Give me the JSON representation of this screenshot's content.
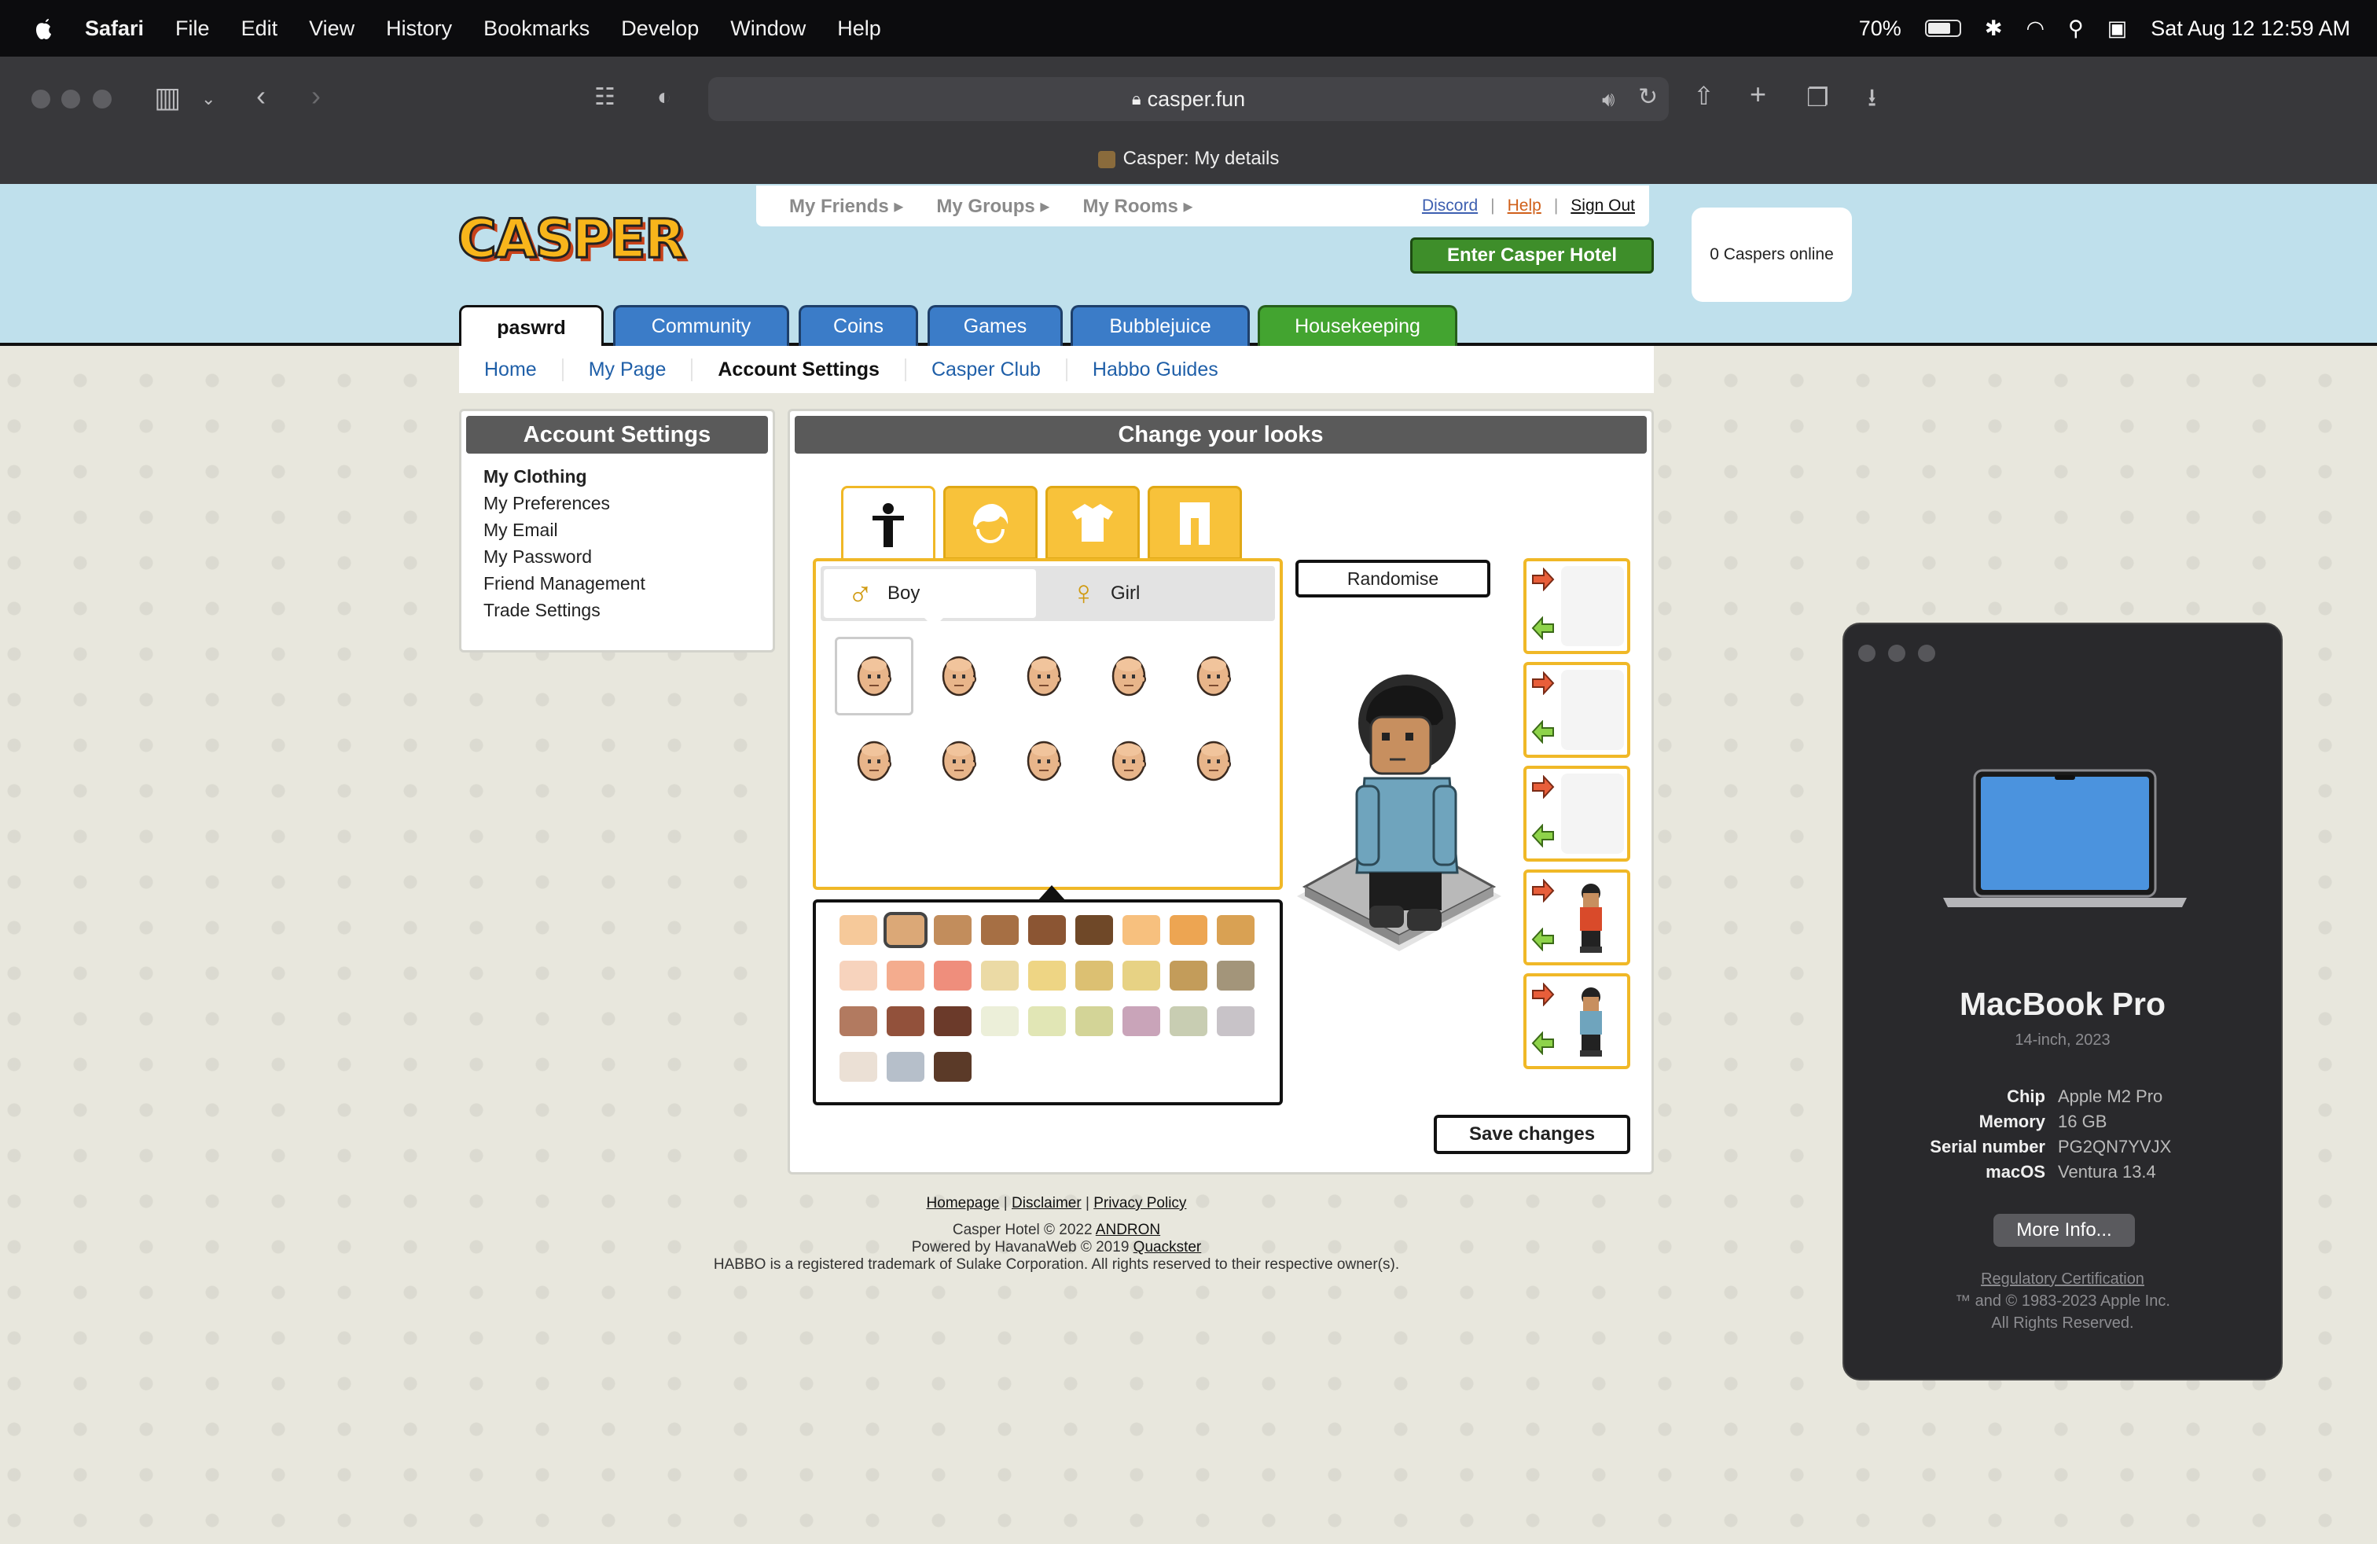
{
  "menubar": {
    "app": "Safari",
    "items": [
      "File",
      "Edit",
      "View",
      "History",
      "Bookmarks",
      "Develop",
      "Window",
      "Help"
    ],
    "battery": "70%",
    "datetime": "Sat Aug 12  12:59 AM"
  },
  "browser": {
    "url": "casper.fun",
    "tab_title": "Casper: My details"
  },
  "site": {
    "logo": "CASPER",
    "subnav": [
      "My Friends",
      "My Groups",
      "My Rooms"
    ],
    "links": {
      "discord": "Discord",
      "help": "Help",
      "signout": "Sign Out"
    },
    "enter_button": "Enter Casper Hotel",
    "online": "0 Caspers online",
    "tabs": [
      "paswrd",
      "Community",
      "Coins",
      "Games",
      "Bubblejuice",
      "Housekeeping"
    ],
    "menu": [
      "Home",
      "My Page",
      "Account Settings",
      "Casper Club",
      "Habbo Guides"
    ]
  },
  "account_settings": {
    "title": "Account Settings",
    "items": [
      "My Clothing",
      "My Preferences",
      "My Email",
      "My Password",
      "Friend Management",
      "Trade Settings"
    ]
  },
  "looks": {
    "title": "Change your looks",
    "boy": "Boy",
    "girl": "Girl",
    "randomise": "Randomise",
    "save": "Save changes",
    "swatch_colors": [
      "#f6c99a",
      "#dba877",
      "#c28d5c",
      "#a66f44",
      "#8b5533",
      "#6f4828",
      "#f7c07e",
      "#eda552",
      "#d9a153",
      "#f7d3bd",
      "#f4ac8e",
      "#ef8e7c",
      "#ebdaa5",
      "#eed584",
      "#dcc072",
      "#e7d284",
      "#c39c5a",
      "#a3957a",
      "#b27a60",
      "#92513b",
      "#6b3a2a",
      "#ecefd9",
      "#e1e6b5",
      "#d3d497",
      "#c9a4b9",
      "#c8cdb2",
      "#c8c3c8",
      "#ebe0d5",
      "#b6bfca",
      "#5b3a28"
    ],
    "selected_swatch": 1
  },
  "footer": {
    "links": [
      "Homepage",
      "Disclaimer",
      "Privacy Policy"
    ],
    "line1_prefix": "Casper Hotel © 2022",
    "line1_link": "ANDRON",
    "line2_prefix": "Powered by HavanaWeb © 2019",
    "line2_link": "Quackster",
    "line3": "HABBO is a registered trademark of Sulake Corporation. All rights reserved to their respective owner(s)."
  },
  "about_mac": {
    "name": "MacBook Pro",
    "model": "14-inch, 2023",
    "specs": [
      {
        "k": "Chip",
        "v": "Apple M2 Pro"
      },
      {
        "k": "Memory",
        "v": "16 GB"
      },
      {
        "k": "Serial number",
        "v": "PG2QN7YVJX"
      },
      {
        "k": "macOS",
        "v": "Ventura 13.4"
      }
    ],
    "more_info": "More Info...",
    "regulatory": "Regulatory Certification",
    "copyright": "™ and © 1983-2023 Apple Inc.",
    "rights": "All Rights Reserved."
  }
}
